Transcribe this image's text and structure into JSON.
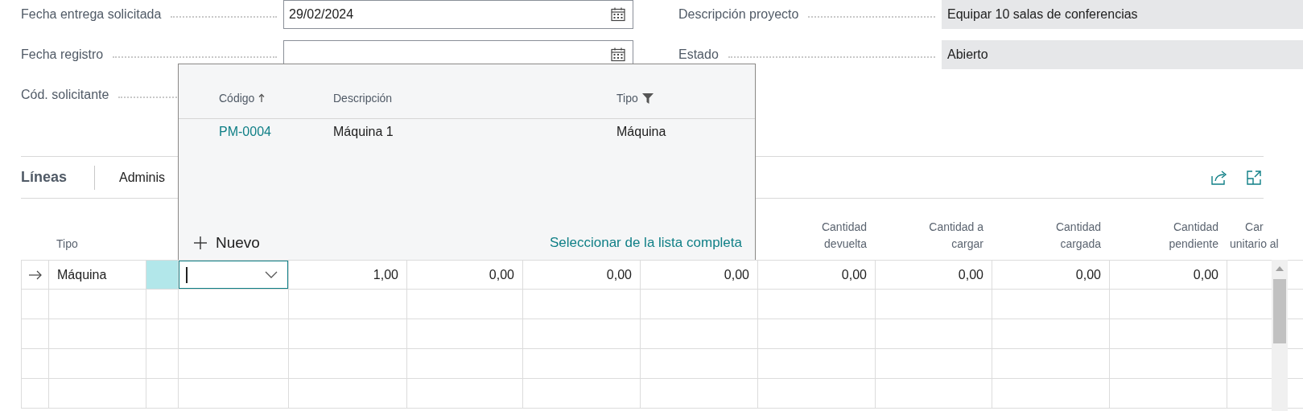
{
  "form": {
    "left": [
      {
        "label": "Fecha entrega solicitada",
        "kind": "date",
        "value": "29/02/2024"
      },
      {
        "label": "Fecha registro",
        "kind": "date"
      },
      {
        "label": "Cód. solicitante"
      }
    ],
    "right": [
      {
        "label": "Descripción proyecto",
        "value": "Equipar 10 salas de conferencias"
      },
      {
        "label": "Estado",
        "value": "Abierto"
      }
    ]
  },
  "lines": {
    "title": "Líneas",
    "tabs": [
      "Adminis"
    ]
  },
  "table": {
    "columns": [
      "",
      "Tipo",
      "",
      "",
      "",
      "",
      "",
      "",
      "Cantidad\ndevuelta",
      "Cantidad a\ncargar",
      "Cantidad\ncargada",
      "Cantidad\npendiente",
      "Car\nunitario al"
    ],
    "rows": [
      {
        "current": true,
        "cells": [
          {
            "kind": "marker"
          },
          {
            "text": "Máquina"
          },
          {
            "kind": "indicator"
          },
          {
            "kind": "lookup",
            "focused": true
          },
          {
            "text": "1,00"
          },
          {
            "text": "0,00"
          },
          {
            "text": "0,00"
          },
          {
            "text": "0,00"
          },
          {
            "text": "0,00"
          },
          {
            "text": "0,00"
          },
          {
            "text": "0,00"
          },
          {
            "text": "0,00"
          }
        ]
      }
    ]
  },
  "lookup": {
    "columns": [
      {
        "label": "Código",
        "sorted": true,
        "filtered": false
      },
      {
        "label": "Descripción",
        "sorted": false,
        "filtered": false
      },
      {
        "label": "Tipo",
        "sorted": false,
        "filtered": true
      }
    ],
    "rows": [
      {
        "cells": [
          "PM-0004",
          "Máquina 1",
          "Máquina"
        ]
      }
    ],
    "new_label": "Nuevo",
    "full_list_link": "Seleccionar de la lista completa"
  }
}
